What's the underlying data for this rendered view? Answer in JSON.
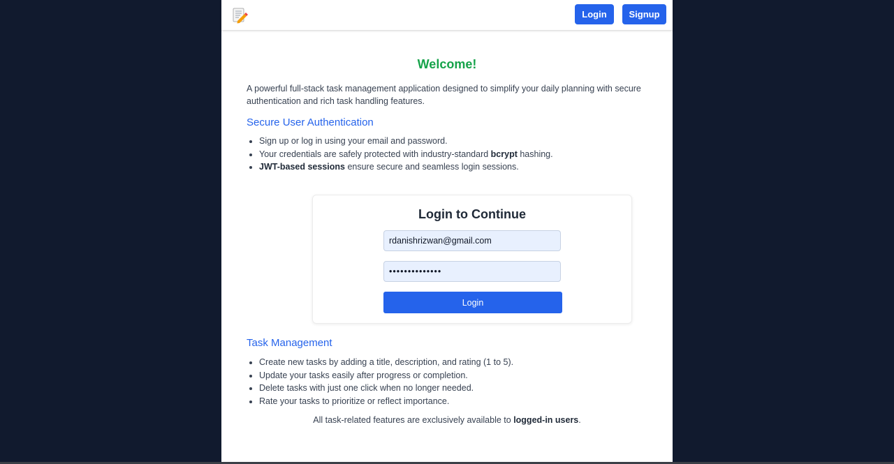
{
  "navbar": {
    "logo_icon": "memo-pencil-icon",
    "login_label": "Login",
    "signup_label": "Signup"
  },
  "main": {
    "welcome": "Welcome!",
    "intro": "A powerful full-stack task management application designed to simplify your daily planning with secure authentication and rich task handling features.",
    "auth_section": {
      "title": "Secure User Authentication",
      "items": [
        {
          "text": "Sign up or log in using your email and password."
        },
        {
          "pre": "Your credentials are safely protected with industry-standard ",
          "bold": "bcrypt",
          "post": " hashing."
        },
        {
          "bold": "JWT-based sessions",
          "post": " ensure secure and seamless login sessions."
        }
      ]
    },
    "login_form": {
      "title": "Login to Continue",
      "email_value": "rdanishrizwan@gmail.com",
      "password_value": "••••••••••••••",
      "submit_label": "Login"
    },
    "task_section": {
      "title": "Task Management",
      "items": [
        "Create new tasks by adding a title, description, and rating (1 to 5).",
        "Update your tasks easily after progress or completion.",
        "Delete tasks with just one click when no longer needed.",
        "Rate your tasks to prioritize or reflect importance."
      ]
    },
    "footer_note": {
      "pre": "All task-related features are exclusively available to ",
      "bold": "logged-in users",
      "post": "."
    }
  },
  "colors": {
    "background": "#111a2e",
    "accent": "#2563eb",
    "welcome": "#16a34a",
    "input_fill": "#e8f0fe"
  }
}
